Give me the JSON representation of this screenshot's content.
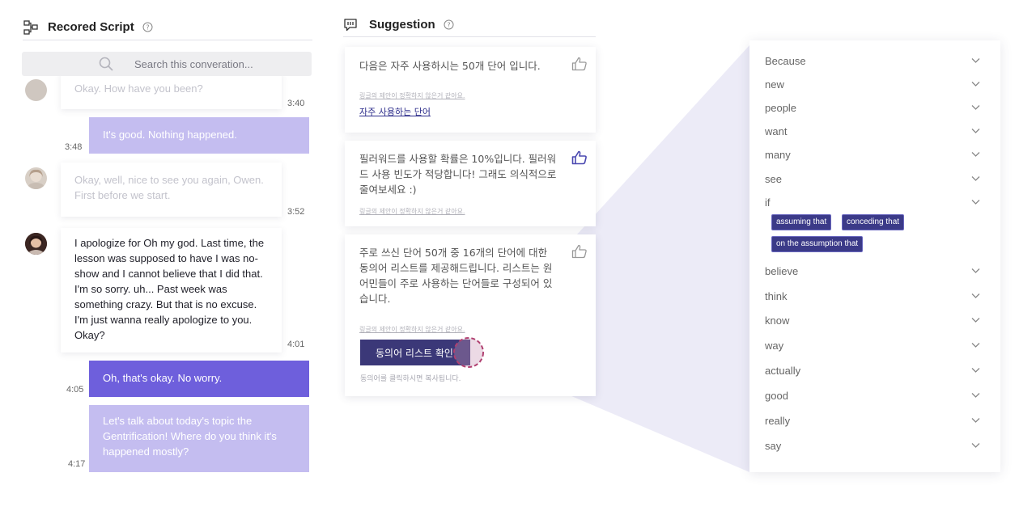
{
  "script_panel": {
    "title": "Recored Script",
    "search_placeholder": "Search this converation...",
    "messages": [
      {
        "text": "Okay. How have you been?",
        "time": "3:40"
      },
      {
        "text": "It's good. Nothing happened.",
        "time": "3:48"
      },
      {
        "text": "Okay, well, nice to see you again, Owen. First before we start.",
        "time": "3:52"
      },
      {
        "text": "I apologize for Oh my god. Last time, the lesson was supposed to have I was no-show and I cannot believe that I did that. I'm so sorry. uh... Past week was something crazy. But that is no excuse. I'm just wanna really apologize to you. Okay?",
        "time": "4:01"
      },
      {
        "text": "Oh, that's okay. No worry.",
        "time": "4:05"
      },
      {
        "text": "Let's talk about today's topic the Gentrification! Where do you think it's happened mostly?",
        "time": "4:17"
      }
    ]
  },
  "suggestion_panel": {
    "title": "Suggestion",
    "cards": [
      {
        "text": "다음은 자주 사용하시는 50개 단어 입니다.",
        "note": "링글의 제안이 정확하지 않은거 같아요.",
        "link": "자주 사용하는 단어"
      },
      {
        "text": "필러워드를 사용할 확률은 10%입니다. 필러워드 사용 빈도가 적당합니다! 그래도 의식적으로 줄여보세요 :)",
        "note": "링글의 제안이 정확하지 않은거 같아요."
      },
      {
        "text": "주로 쓰신 단어 50개 중 16개의 단어에 대한 동의어 리스트를 제공해드립니다. 리스트는 원어민들이 주로 사용하는 단어들로 구성되어 있습니다.",
        "note": "링글의 제안이 정확하지 않은거 같아요.",
        "button": "동의어 리스트 확인",
        "hint": "동의어를 클릭하시면 복사됩니다."
      }
    ]
  },
  "word_list": {
    "words": [
      "Because",
      "new",
      "people",
      "want",
      "many",
      "see",
      "if",
      "believe",
      "think",
      "know",
      "way",
      "actually",
      "good",
      "really",
      "say"
    ],
    "expanded_tags": [
      "assuming that",
      "conceding that",
      "on the assumption that"
    ]
  },
  "colors": {
    "accent": "#3b3878",
    "bubble_light": "#c4bdf0",
    "bubble_dark": "#6e5fdc",
    "thumb_active": "#4a48b0",
    "highlight_ring": "#b04070"
  },
  "icons": [
    "flow-icon",
    "help-icon",
    "search-icon",
    "speech-icon",
    "thumbs-up-icon",
    "chevron-down-icon"
  ]
}
